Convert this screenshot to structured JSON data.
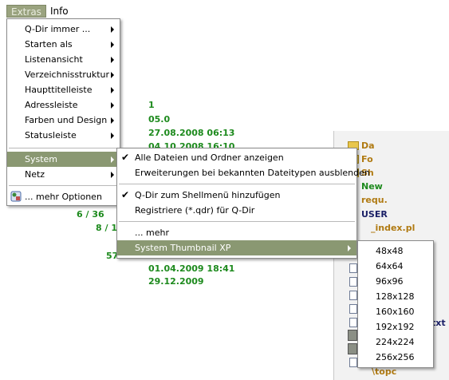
{
  "menubar": {
    "extras": "Extras",
    "info": "Info"
  },
  "extras_menu": {
    "items": [
      "Q-Dir immer ...",
      "Starten als",
      "Listenansicht",
      "Verzeichnisstruktur",
      "Haupttitelleiste",
      "Adressleiste",
      "Farben und Design",
      "Statusleiste"
    ],
    "system": "System",
    "netz": "Netz",
    "more_options": "... mehr Optionen"
  },
  "system_menu": {
    "show_all": "Alle Dateien und Ordner anzeigen",
    "hide_ext": "Erweiterungen bei bekannten Dateitypen ausblenden",
    "add_shell": "Q-Dir zum Shellmenü hinzufügen",
    "register": "Registriere (*.qdr) für Q-Dir",
    "more": "... mehr",
    "thumbnail": "System Thumbnail XP"
  },
  "thumbnail_menu": {
    "sizes": [
      "48x48",
      "64x64",
      "96x96",
      "128x128",
      "160x160",
      "192x192",
      "224x224",
      "256x256"
    ]
  },
  "background": {
    "items": [
      {
        "text": "1",
        "c": "g"
      },
      {
        "text": "05.0",
        "c": "g"
      },
      {
        "text": "27.08.2008 06:13",
        "c": "g"
      },
      {
        "text": "04.10.2008 16:10",
        "c": "g"
      },
      {
        "text": "Da",
        "c": "o"
      },
      {
        "text": "Fo",
        "c": "o"
      },
      {
        "text": "Sh",
        "c": "o"
      },
      {
        "text": "New",
        "c": "g"
      },
      {
        "text": "requ.",
        "c": "o"
      },
      {
        "text": "USER",
        "c": "n"
      },
      {
        "text": "_index.pl",
        "c": "o"
      },
      {
        "text": "6 / 36",
        "c": "g"
      },
      {
        "text": "8 / 1",
        "c": "g"
      },
      {
        "text": "57",
        "c": "g"
      },
      {
        "text": "01.04.2009 18:41",
        "c": "g"
      },
      {
        "text": "29.12.2009",
        "c": "g"
      },
      {
        "text": "txt",
        "c": "n"
      },
      {
        "text": "\\topc",
        "c": "o"
      }
    ]
  }
}
